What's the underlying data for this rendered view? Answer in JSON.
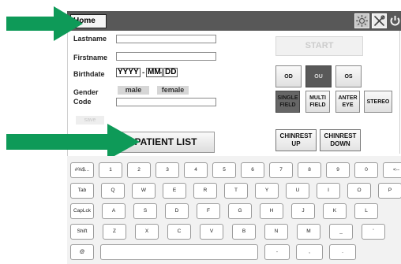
{
  "toolbar": {
    "home_tab": "Home",
    "icons": [
      "settings-sun-icon",
      "tools-icon",
      "power-icon"
    ]
  },
  "form": {
    "lastname_label": "Lastname",
    "lastname_value": "",
    "firstname_label": "Firstname",
    "firstname_value": "",
    "birthdate_label": "Birthdate",
    "birthdate": {
      "year": "YYYY",
      "month": "MM",
      "day": "DD",
      "separator": "-"
    },
    "gender_label": "Gender",
    "gender_options": [
      "male",
      "female"
    ],
    "code_label": "Code",
    "code_value": "",
    "save_label": "save"
  },
  "controls": {
    "start_label": "START",
    "eyes": [
      {
        "label": "OD",
        "active": false
      },
      {
        "label": "OU",
        "active": true
      },
      {
        "label": "OS",
        "active": false
      }
    ],
    "modes": [
      {
        "label": "SINGLE FIELD",
        "active": true
      },
      {
        "label": "MULTI FIELD",
        "active": false
      },
      {
        "label": "ANTER EYE",
        "active": false
      },
      {
        "label": "STEREO",
        "active": false
      }
    ],
    "chinrest_up": "CHINREST UP",
    "chinrest_down": "CHINREST DOWN",
    "patient_list": "PATIENT LIST"
  },
  "keyboard": {
    "row1": [
      "#%$...",
      "1",
      "2",
      "3",
      "4",
      "5",
      "6",
      "7",
      "8",
      "9",
      "0",
      "<--"
    ],
    "row2": [
      "Tab",
      "Q",
      "W",
      "E",
      "R",
      "T",
      "Y",
      "U",
      "I",
      "O",
      "P"
    ],
    "row3": [
      "CapLck",
      "A",
      "S",
      "D",
      "F",
      "G",
      "H",
      "J",
      "K",
      "L"
    ],
    "row4": [
      "Shift",
      "Z",
      "X",
      "C",
      "V",
      "B",
      "N",
      "M",
      "_",
      "'"
    ],
    "row5": [
      "@",
      "",
      "-",
      ",",
      "."
    ]
  },
  "colors": {
    "toolbar_bg": "#585858",
    "arrow_green": "#0e9a58",
    "active_button": "#595959"
  }
}
